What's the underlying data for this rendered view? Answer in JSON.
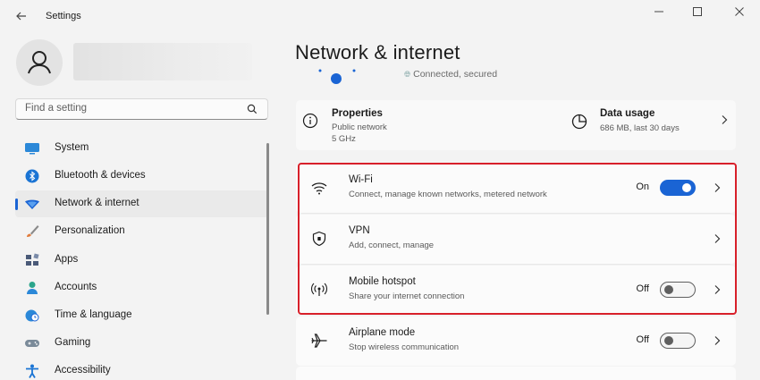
{
  "app": {
    "title": "Settings",
    "back_icon": "back-arrow-icon"
  },
  "window_controls": {
    "minimize": "—",
    "maximize": "☐",
    "close": "✕"
  },
  "search": {
    "placeholder": "Find a setting",
    "icon": "search-icon"
  },
  "sidebar": {
    "items": [
      {
        "label": "System",
        "icon": "system-icon",
        "color": "#2b88d8"
      },
      {
        "label": "Bluetooth & devices",
        "icon": "bluetooth-icon",
        "color": "#1a74d4"
      },
      {
        "label": "Network & internet",
        "icon": "wifi-diamond-icon",
        "color": "#1a64d4",
        "active": true
      },
      {
        "label": "Personalization",
        "icon": "brush-icon",
        "color": "#e07a3a"
      },
      {
        "label": "Apps",
        "icon": "apps-icon",
        "color": "#4a5a78"
      },
      {
        "label": "Accounts",
        "icon": "accounts-icon",
        "color": "#2ba58b"
      },
      {
        "label": "Time & language",
        "icon": "globe-clock-icon",
        "color": "#2b88d8"
      },
      {
        "label": "Gaming",
        "icon": "gamepad-icon",
        "color": "#7a8a99"
      },
      {
        "label": "Accessibility",
        "icon": "accessibility-icon",
        "color": "#1a74d4"
      }
    ]
  },
  "main": {
    "title": "Network & internet",
    "status": "Connected, secured",
    "properties": {
      "title": "Properties",
      "line1": "Public network",
      "line2": "5 GHz",
      "icon": "info-icon"
    },
    "data_usage": {
      "title": "Data usage",
      "sub": "686 MB, last 30 days",
      "icon": "pie-chart-icon"
    },
    "rows": [
      {
        "title": "Wi-Fi",
        "sub": "Connect, manage known networks, metered network",
        "state": "On",
        "toggle": "on",
        "icon": "wifi-icon"
      },
      {
        "title": "VPN",
        "sub": "Add, connect, manage",
        "state": "",
        "toggle": "none",
        "icon": "shield-icon"
      },
      {
        "title": "Mobile hotspot",
        "sub": "Share your internet connection",
        "state": "Off",
        "toggle": "off",
        "icon": "hotspot-icon"
      },
      {
        "title": "Airplane mode",
        "sub": "Stop wireless communication",
        "state": "Off",
        "toggle": "off",
        "icon": "airplane-icon"
      }
    ]
  },
  "colors": {
    "accent": "#1a64d4",
    "highlight": "#d8202a"
  }
}
